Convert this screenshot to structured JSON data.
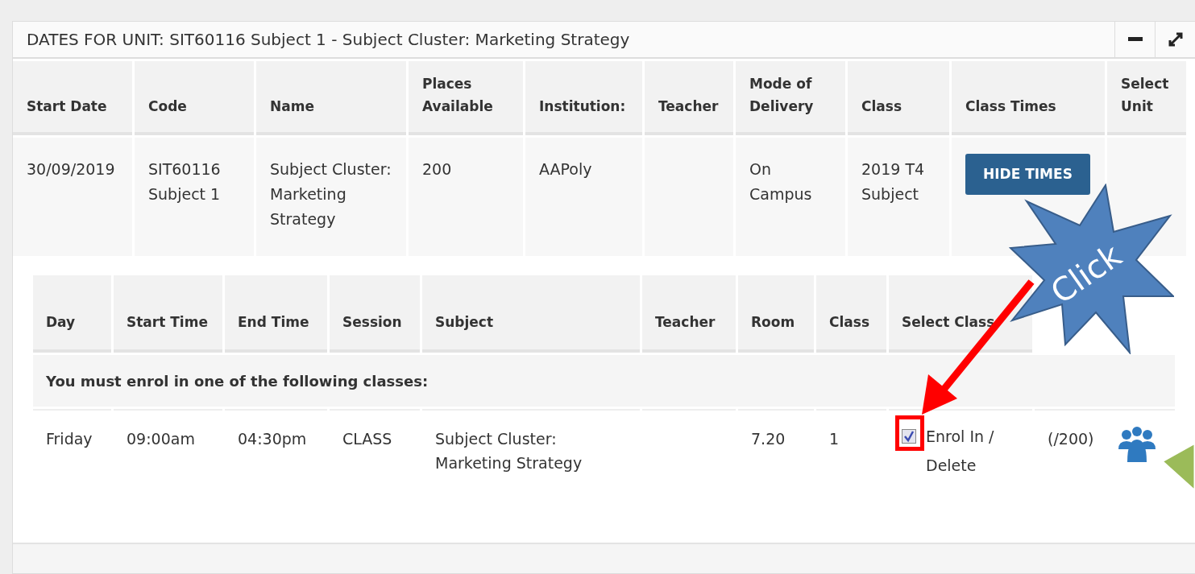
{
  "panel": {
    "title": "DATES FOR UNIT: SIT60116 Subject 1 - Subject Cluster: Marketing Strategy",
    "controls": [
      {
        "kind": "minimize"
      },
      {
        "kind": "expand"
      }
    ]
  },
  "units": {
    "columns": [
      "Start Date",
      "Code",
      "Name",
      "Places Available",
      "Institution:",
      "Teacher",
      "Mode of Delivery",
      "Class",
      "Class Times",
      "Select Unit"
    ],
    "rows": [
      {
        "start_date": "30/09/2019",
        "code": "SIT60116 Subject 1",
        "name": "Subject Cluster: Marketing Strategy",
        "places": "200",
        "institution": "AAPoly",
        "mode": "On Campus",
        "class": "2019 T4 Subject",
        "times_button": "HIDE TIMES"
      }
    ]
  },
  "class_times": {
    "columns": [
      "Day",
      "Start Time",
      "End Time",
      "Session",
      "Subject",
      "Teacher",
      "Room",
      "Class",
      "Select Class"
    ],
    "notice": "You must enrol in one of the following classes:",
    "rows": [
      {
        "day": "Friday",
        "start": "09:00am",
        "end": "04:30pm",
        "session": "CLASS",
        "subject": "Subject Cluster: Marketing Strategy",
        "room": "7.20",
        "class": "1",
        "enrol": {
          "checked": true,
          "label": "Enrol In / Delete"
        },
        "places": "(/200)"
      }
    ]
  },
  "annotation": {
    "text": "Click"
  }
}
